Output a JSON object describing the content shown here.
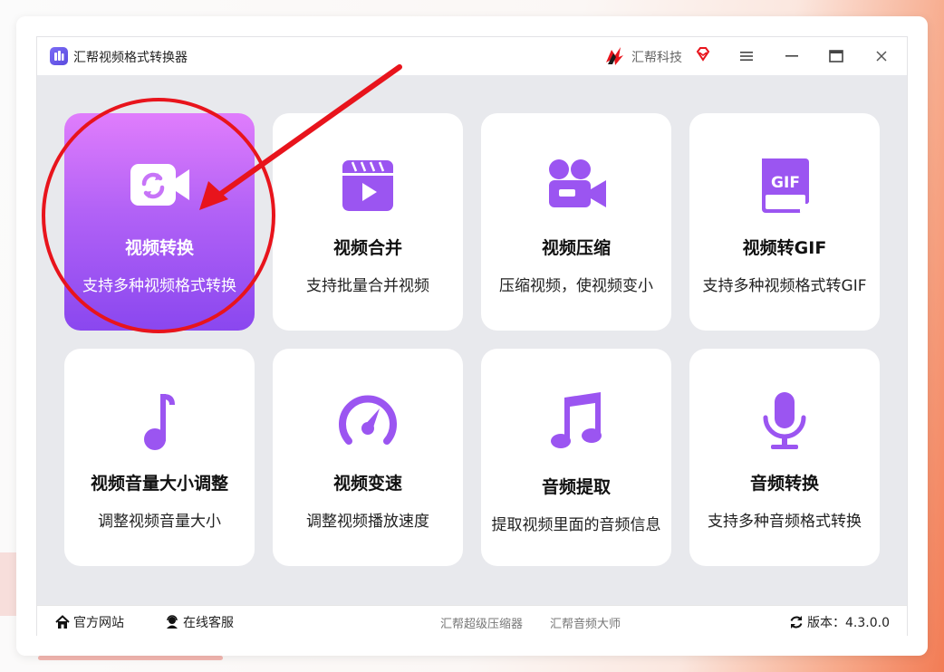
{
  "window": {
    "title": "汇帮视频格式转换器",
    "brand": "汇帮科技",
    "controls": [
      "menu",
      "minimize",
      "maximize",
      "close"
    ]
  },
  "features": [
    {
      "id": "video-convert",
      "title": "视频转换",
      "desc": "支持多种视频格式转换",
      "icon": "video-convert-icon",
      "active": true
    },
    {
      "id": "video-merge",
      "title": "视频合并",
      "desc": "支持批量合并视频",
      "icon": "video-merge-icon",
      "active": false
    },
    {
      "id": "video-compress",
      "title": "视频压缩",
      "desc": "压缩视频，使视频变小",
      "icon": "video-camera-icon",
      "active": false
    },
    {
      "id": "video-to-gif",
      "title": "视频转GIF",
      "desc": "支持多种视频格式转GIF",
      "icon": "gif-icon",
      "active": false
    },
    {
      "id": "volume-adjust",
      "title": "视频音量大小调整",
      "desc": "调整视频音量大小",
      "icon": "music-note-icon",
      "active": false
    },
    {
      "id": "speed-change",
      "title": "视频变速",
      "desc": "调整视频播放速度",
      "icon": "speedometer-icon",
      "active": false
    },
    {
      "id": "audio-extract",
      "title": "音频提取",
      "desc": "提取视频里面的音频信息",
      "icon": "music-notes-icon",
      "active": false
    },
    {
      "id": "audio-convert",
      "title": "音频转换",
      "desc": "支持多种音频格式转换",
      "icon": "microphone-icon",
      "active": false
    }
  ],
  "footer": {
    "website": "官方网站",
    "support": "在线客服",
    "links": [
      "汇帮超级压缩器",
      "汇帮音频大师"
    ],
    "version": "版本：4.3.0.0"
  },
  "colors": {
    "accent": "#8a47ef",
    "accent_light": "#e07dfc",
    "icon_purple": "#9b55f1",
    "annotation_red": "#e8141c"
  }
}
